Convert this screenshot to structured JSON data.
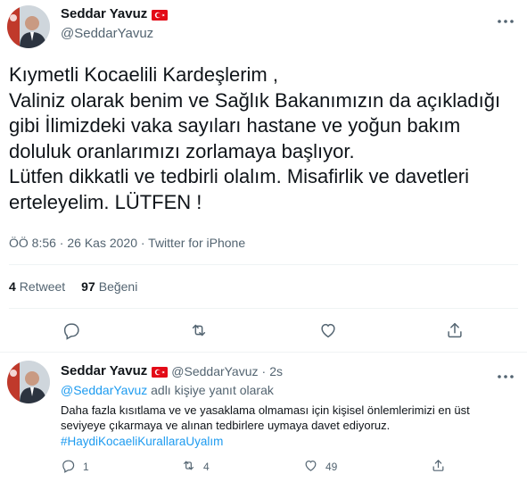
{
  "main_tweet": {
    "display_name": "Seddar Yavuz",
    "handle": "@SeddarYavuz",
    "text": "Kıymetli Kocaelili Kardeşlerim ,\nValiniz olarak benim ve Sağlık Bakanımızın da açıkladığı gibi İlimizdeki vaka sayıları hastane ve yoğun bakım doluluk oranlarımızı zorlamaya başlıyor.\nLütfen dikkatli ve tedbirli olalım. Misafirlik ve davetleri erteleyelim. LÜTFEN !",
    "timestamp": "ÖÖ 8:56 · 26 Kas 2020 · Twitter for iPhone",
    "retweet_count": "4",
    "retweet_label": "Retweet",
    "like_count": "97",
    "like_label": "Beğeni"
  },
  "reply_tweet": {
    "display_name": "Seddar Yavuz",
    "handle": "@SeddarYavuz",
    "separator": "·",
    "time": "2s",
    "replying_to_handle": "@SeddarYavuz",
    "replying_to_suffix": " adlı kişiye yanıt olarak",
    "text": "Daha fazla kısıtlama ve ve yasaklama olmaması için kişisel önlemlerimizi en üst seviyeye çıkarmaya ve alınan tedbirlere uymaya davet ediyoruz.",
    "hashtag": "#HaydiKocaeliKurallaraUyalım",
    "reply_count": "1",
    "retweet_count": "4",
    "like_count": "49"
  },
  "icons": {
    "more": "more-icon",
    "reply": "reply-icon",
    "retweet": "retweet-icon",
    "like": "heart-icon",
    "share": "share-icon",
    "flag": "turkey-flag-icon"
  },
  "colors": {
    "text": "#0f1419",
    "secondary": "#536471",
    "link": "#1d9bf0",
    "flag_red": "#e30a17",
    "divider": "#eff3f4"
  }
}
